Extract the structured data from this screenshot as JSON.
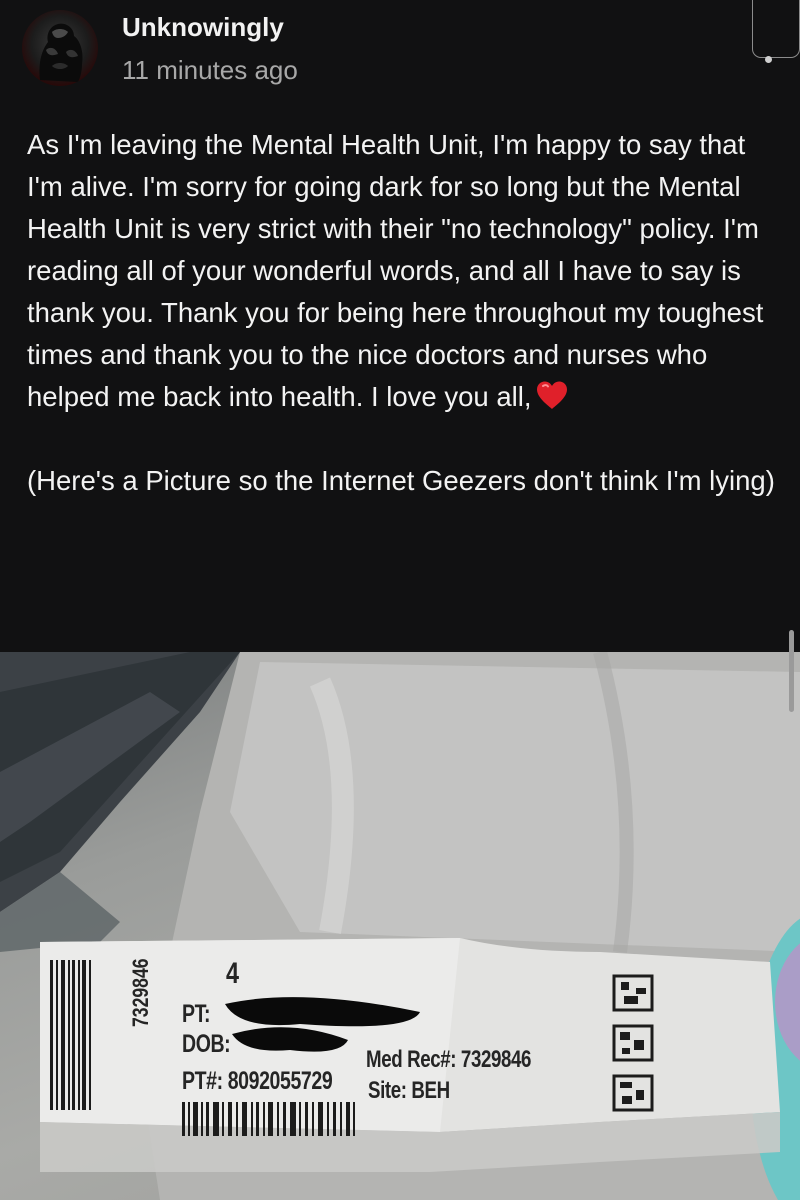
{
  "post": {
    "username": "Unknowingly",
    "timestamp": "11 minutes ago",
    "paragraph1": "As I'm leaving the Mental Health Unit, I'm happy to say that I'm alive. I'm sorry for going dark for so long but the Mental Health Unit is very strict with their \"no technology\" policy. I'm reading all of your wonderful words, and all I have to say is thank you. Thank you for being here throughout my toughest times and thank you to the nice doctors and nurses who helped me back into health. I love you all,",
    "paragraph2": "(Here's a Picture so the Internet Geezers don't think I'm lying)"
  },
  "icons": {
    "heart": "red-heart-emoji",
    "more": "more-options-dot"
  },
  "wristband": {
    "number": "4",
    "pt_label": "PT:",
    "dob_label": "DOB:",
    "med_rec": "Med Rec#: 7329846",
    "pt_number": "PT#: 8092055729",
    "site": "Site: BEH",
    "side_id": "7329846"
  },
  "colors": {
    "background": "#111112",
    "text": "#f3f3f3",
    "muted": "#a8a8a8",
    "heart": "#e0202a"
  }
}
